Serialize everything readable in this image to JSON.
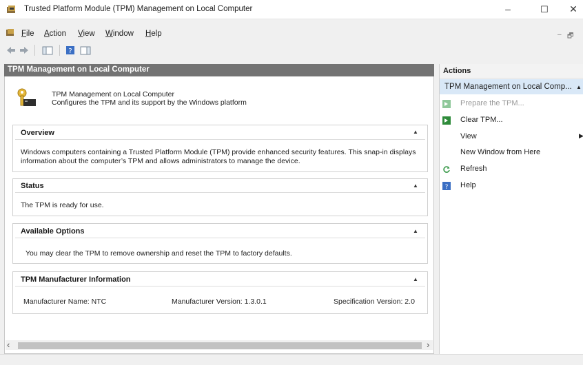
{
  "window": {
    "title": "Trusted Platform Module (TPM) Management on Local Computer",
    "minimize_glyph": "–",
    "maximize_glyph": "☐",
    "close_glyph": "✕"
  },
  "menu": {
    "items": [
      {
        "label": "File",
        "underline": "F",
        "rest": "ile"
      },
      {
        "label": "Action",
        "underline": "A",
        "rest": "ction"
      },
      {
        "label": "View",
        "underline": "V",
        "rest": "iew"
      },
      {
        "label": "Window",
        "underline": "W",
        "rest": "indow"
      },
      {
        "label": "Help",
        "underline": "H",
        "rest": "elp"
      }
    ],
    "mdi_min": "–",
    "mdi_restore": "🗗"
  },
  "main": {
    "header": "TPM Management on Local Computer",
    "hero": {
      "title": "TPM Management on Local Computer",
      "description": "Configures the TPM and its support by the Windows platform"
    },
    "sections": {
      "overview": {
        "title": "Overview",
        "text1": "Windows computers containing a Trusted Platform Module (TPM) provide enhanced security features. This snap-in displays",
        "text2": "information about the computer’s TPM and allows administrators to manage the device."
      },
      "status": {
        "title": "Status",
        "text": "The TPM is ready for use."
      },
      "options": {
        "title": "Available Options",
        "text": "You may clear the TPM to remove ownership and reset the TPM to factory defaults."
      },
      "manufacturer": {
        "title": "TPM Manufacturer Information",
        "name": "Manufacturer Name:  NTC",
        "version": "Manufacturer Version:  1.3.0.1",
        "spec": "Specification Version:  2.0"
      }
    },
    "scroll_left": "‹",
    "scroll_right": "›"
  },
  "actions": {
    "header": "Actions",
    "group": "TPM Management on Local Comp...",
    "items": [
      {
        "label": "Prepare the TPM...",
        "enabled": false
      },
      {
        "label": "Clear TPM...",
        "enabled": true
      },
      {
        "label": "View",
        "enabled": true
      },
      {
        "label": "New Window from Here",
        "enabled": true
      },
      {
        "label": "Refresh",
        "enabled": true
      },
      {
        "label": "Help",
        "enabled": true
      }
    ]
  },
  "colors": {
    "header_gray": "#737373",
    "selection_blue": "#d9e8f7",
    "icon_green": "#2e8b3a",
    "icon_blue": "#3b6fc4"
  }
}
